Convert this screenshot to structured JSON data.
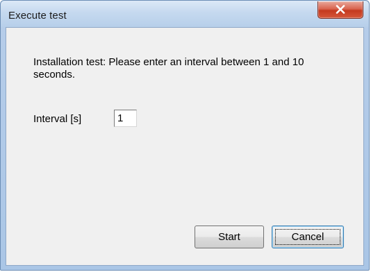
{
  "window": {
    "title": "Execute test",
    "close_icon": "close-x-icon"
  },
  "content": {
    "instruction": "Installation test: Please enter an interval between 1 and 10 seconds.",
    "interval_label": "Interval [s]",
    "interval_value": "1"
  },
  "buttons": {
    "start_label": "Start",
    "cancel_label": "Cancel"
  },
  "colors": {
    "close_button": "#c4391f",
    "dialog_background": "#f0f0f0",
    "frame": "#b6cde9"
  }
}
